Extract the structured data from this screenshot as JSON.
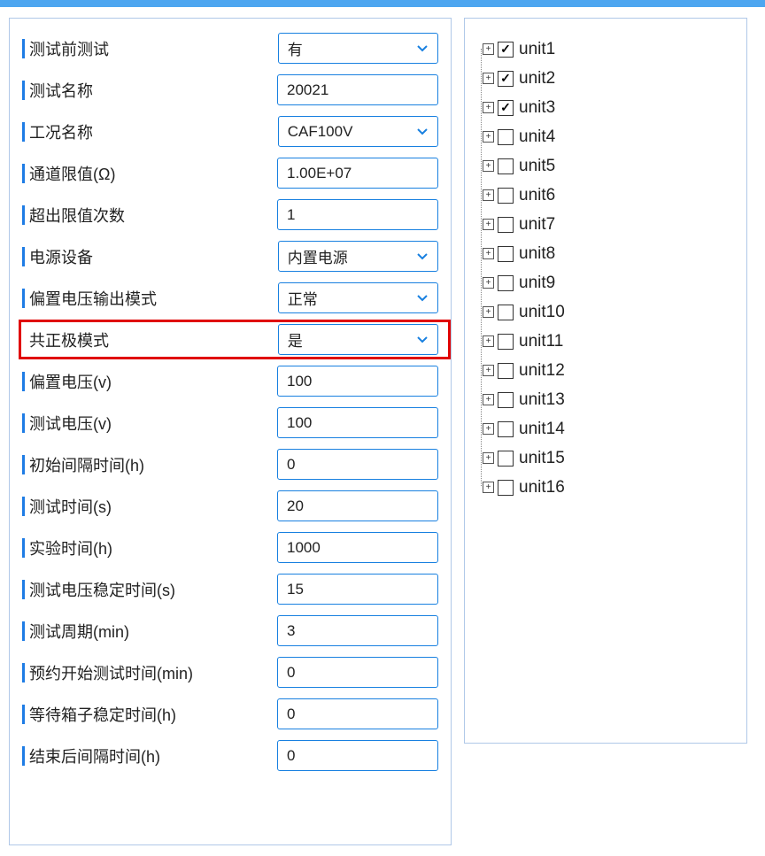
{
  "form": {
    "rows": [
      {
        "label": "测试前测试",
        "type": "select",
        "value": "有",
        "highlighted": false
      },
      {
        "label": "测试名称",
        "type": "input",
        "value": "20021",
        "highlighted": false
      },
      {
        "label": "工况名称",
        "type": "select",
        "value": "CAF100V",
        "highlighted": false
      },
      {
        "label": "通道限值(Ω)",
        "type": "input",
        "value": "1.00E+07",
        "highlighted": false
      },
      {
        "label": "超出限值次数",
        "type": "input",
        "value": "1",
        "highlighted": false
      },
      {
        "label": "电源设备",
        "type": "select",
        "value": "内置电源",
        "highlighted": false
      },
      {
        "label": "偏置电压输出模式",
        "type": "select",
        "value": "正常",
        "highlighted": false
      },
      {
        "label": "共正极模式",
        "type": "select",
        "value": "是",
        "highlighted": true
      },
      {
        "label": "偏置电压(v)",
        "type": "input",
        "value": "100",
        "highlighted": false
      },
      {
        "label": "测试电压(v)",
        "type": "input",
        "value": "100",
        "highlighted": false
      },
      {
        "label": "初始间隔时间(h)",
        "type": "input",
        "value": "0",
        "highlighted": false
      },
      {
        "label": "测试时间(s)",
        "type": "input",
        "value": "20",
        "highlighted": false
      },
      {
        "label": "实验时间(h)",
        "type": "input",
        "value": "1000",
        "highlighted": false
      },
      {
        "label": "测试电压稳定时间(s)",
        "type": "input",
        "value": "15",
        "highlighted": false
      },
      {
        "label": "测试周期(min)",
        "type": "input",
        "value": "3",
        "highlighted": false
      },
      {
        "label": "预约开始测试时间(min)",
        "type": "input",
        "value": "0",
        "highlighted": false
      },
      {
        "label": "等待箱子稳定时间(h)",
        "type": "input",
        "value": "0",
        "highlighted": false
      },
      {
        "label": "结束后间隔时间(h)",
        "type": "input",
        "value": "0",
        "highlighted": false
      }
    ]
  },
  "tree": {
    "items": [
      {
        "label": "unit1",
        "checked": true
      },
      {
        "label": "unit2",
        "checked": true
      },
      {
        "label": "unit3",
        "checked": true
      },
      {
        "label": "unit4",
        "checked": false
      },
      {
        "label": "unit5",
        "checked": false
      },
      {
        "label": "unit6",
        "checked": false
      },
      {
        "label": "unit7",
        "checked": false
      },
      {
        "label": "unit8",
        "checked": false
      },
      {
        "label": "unit9",
        "checked": false
      },
      {
        "label": "unit10",
        "checked": false
      },
      {
        "label": "unit11",
        "checked": false
      },
      {
        "label": "unit12",
        "checked": false
      },
      {
        "label": "unit13",
        "checked": false
      },
      {
        "label": "unit14",
        "checked": false
      },
      {
        "label": "unit15",
        "checked": false
      },
      {
        "label": "unit16",
        "checked": false
      }
    ]
  },
  "colors": {
    "primary": "#1880e0",
    "highlight": "#e00000",
    "border": "#b0c8e8"
  },
  "chart_data": {
    "type": "table",
    "title": "Test Configuration Parameters",
    "parameters": [
      {
        "name": "测试前测试",
        "value": "有"
      },
      {
        "name": "测试名称",
        "value": "20021"
      },
      {
        "name": "工况名称",
        "value": "CAF100V"
      },
      {
        "name": "通道限值(Ω)",
        "value": "1.00E+07"
      },
      {
        "name": "超出限值次数",
        "value": 1
      },
      {
        "name": "电源设备",
        "value": "内置电源"
      },
      {
        "name": "偏置电压输出模式",
        "value": "正常"
      },
      {
        "name": "共正极模式",
        "value": "是"
      },
      {
        "name": "偏置电压(v)",
        "value": 100
      },
      {
        "name": "测试电压(v)",
        "value": 100
      },
      {
        "name": "初始间隔时间(h)",
        "value": 0
      },
      {
        "name": "测试时间(s)",
        "value": 20
      },
      {
        "name": "实验时间(h)",
        "value": 1000
      },
      {
        "name": "测试电压稳定时间(s)",
        "value": 15
      },
      {
        "name": "测试周期(min)",
        "value": 3
      },
      {
        "name": "预约开始测试时间(min)",
        "value": 0
      },
      {
        "name": "等待箱子稳定时间(h)",
        "value": 0
      },
      {
        "name": "结束后间隔时间(h)",
        "value": 0
      }
    ],
    "units_selected": [
      "unit1",
      "unit2",
      "unit3"
    ],
    "units_total": 16
  }
}
